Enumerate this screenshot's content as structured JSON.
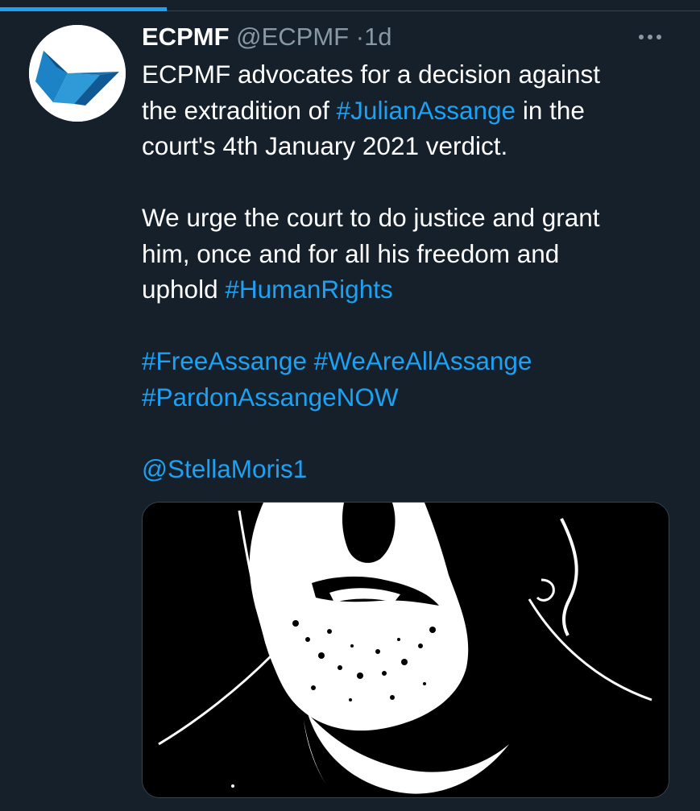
{
  "tweet": {
    "display_name": "ECPMF",
    "handle": "@ECPMF",
    "separator": "·",
    "time": "1d",
    "more_icon": "more-horizontal-icon",
    "paragraphs": {
      "p1": {
        "l1": "ECPMF advocates for a decision against",
        "l2_pre": "the extradition of ",
        "l2_tag": "#JulianAssange",
        "l2_post": " in the",
        "l3": "court's 4th January 2021 verdict."
      },
      "p2": {
        "l1": "We urge the court to do justice and grant",
        "l2": "him, once and for all his freedom and",
        "l3_pre": "uphold ",
        "l3_tag": "#HumanRights"
      },
      "p3": {
        "tag1": "#FreeAssange",
        "tag2": "#WeAreAllAssange",
        "tag3": "#PardonAssangeNOW"
      },
      "p4": {
        "mention": "@StellaMoris1"
      }
    },
    "media": {
      "type": "image",
      "description_icon": "portrait-illustration"
    }
  },
  "colors": {
    "background": "#15202b",
    "accent": "#1da1f2",
    "text": "#ffffff",
    "muted": "#8899a6",
    "border": "#38444d"
  }
}
